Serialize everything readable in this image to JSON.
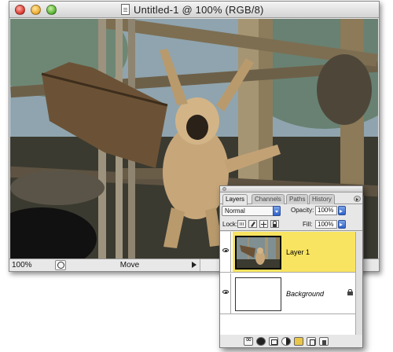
{
  "document": {
    "title": "Untitled-1 @ 100% (RGB/8)",
    "zoom": "100%",
    "status_tool": "Move"
  },
  "icons": {
    "close": "close-icon",
    "minimize": "minimize-icon",
    "zoom": "zoom-icon",
    "document": "document-icon",
    "eye": "eye-icon",
    "lock": "lock-icon"
  },
  "layers_palette": {
    "tabs": [
      "Layers",
      "Channels",
      "Paths",
      "History"
    ],
    "active_tab": "Layers",
    "blend_mode": "Normal",
    "opacity_label": "Opacity:",
    "opacity_value": "100%",
    "lock_label": "Lock:",
    "fill_label": "Fill:",
    "fill_value": "100%",
    "layers": [
      {
        "name": "Layer 1",
        "selected": true,
        "visible": true
      },
      {
        "name": "Background",
        "selected": false,
        "visible": true,
        "locked": true
      }
    ]
  },
  "colors": {
    "selected_layer": "#f8e460",
    "palette_bg": "#e7e7e7"
  }
}
